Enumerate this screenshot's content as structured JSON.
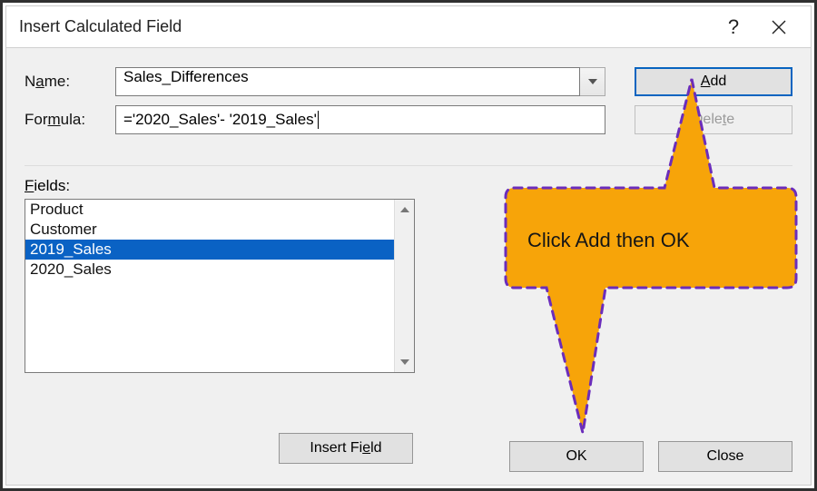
{
  "title": "Insert Calculated Field",
  "labels": {
    "name_prefix": "N",
    "name_underlined": "a",
    "name_suffix": "me:",
    "formula_prefix": "For",
    "formula_underlined": "m",
    "formula_suffix": "ula:",
    "fields_underlined": "F",
    "fields_suffix": "ields:"
  },
  "name_value": "Sales_Differences",
  "formula_value": "='2020_Sales'- '2019_Sales'",
  "buttons": {
    "add_underlined": "A",
    "add_suffix": "dd",
    "delete_prefix": "Dele",
    "delete_underlined": "t",
    "delete_suffix": "e",
    "insert_field": "Insert Fi",
    "insert_field_underlined": "e",
    "insert_field_suffix": "ld",
    "ok": "OK",
    "close": "Close"
  },
  "fields": {
    "items": [
      "Product",
      "Customer",
      "2019_Sales",
      "2020_Sales"
    ],
    "selected_index": 2
  },
  "callout": {
    "text": "Click Add then OK"
  }
}
